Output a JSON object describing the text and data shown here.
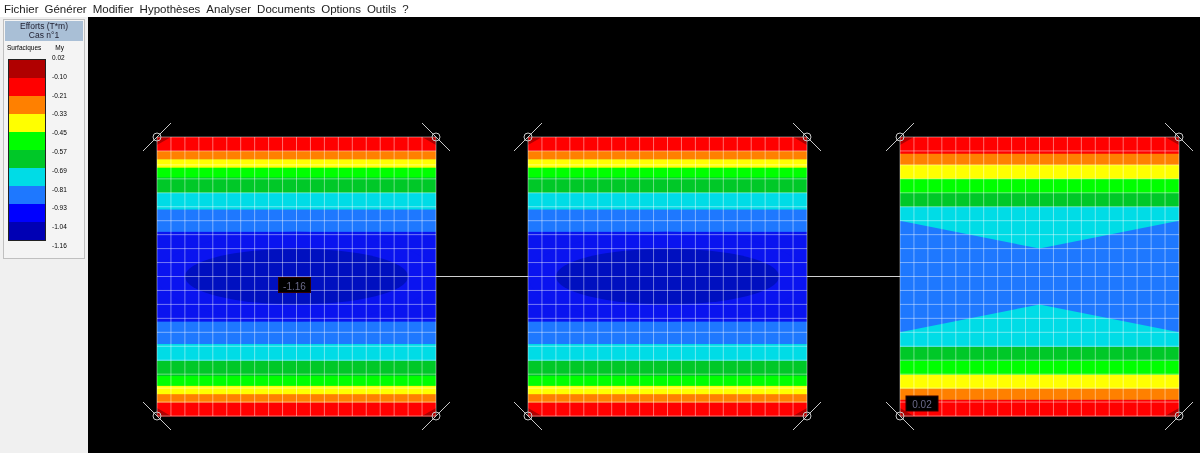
{
  "menu": [
    "Fichier",
    "Générer",
    "Modifier",
    "Hypothèses",
    "Analyser",
    "Documents",
    "Options",
    "Outils",
    "?"
  ],
  "legend": {
    "title": "Efforts (T*m)",
    "subtitle": "Cas n°1",
    "type_label": "Surfaciques",
    "component_label": "My",
    "values": [
      "0.02",
      "-0.10",
      "-0.21",
      "-0.33",
      "-0.45",
      "-0.57",
      "-0.69",
      "-0.81",
      "-0.93",
      "-1.04",
      "-1.16"
    ],
    "bands": [
      {
        "color": "#b00000"
      },
      {
        "color": "#ff0000"
      },
      {
        "color": "#ff8000"
      },
      {
        "color": "#ffff00"
      },
      {
        "color": "#00ff00"
      },
      {
        "color": "#00c828"
      },
      {
        "color": "#00dce6"
      },
      {
        "color": "#1e78ff"
      },
      {
        "color": "#0000ff"
      },
      {
        "color": "#0000b4"
      }
    ]
  },
  "plates": [
    {
      "kind": "ellipse",
      "value_label": "-1.16"
    },
    {
      "kind": "ellipse"
    },
    {
      "kind": "waist",
      "value_label": "0.02"
    }
  ]
}
